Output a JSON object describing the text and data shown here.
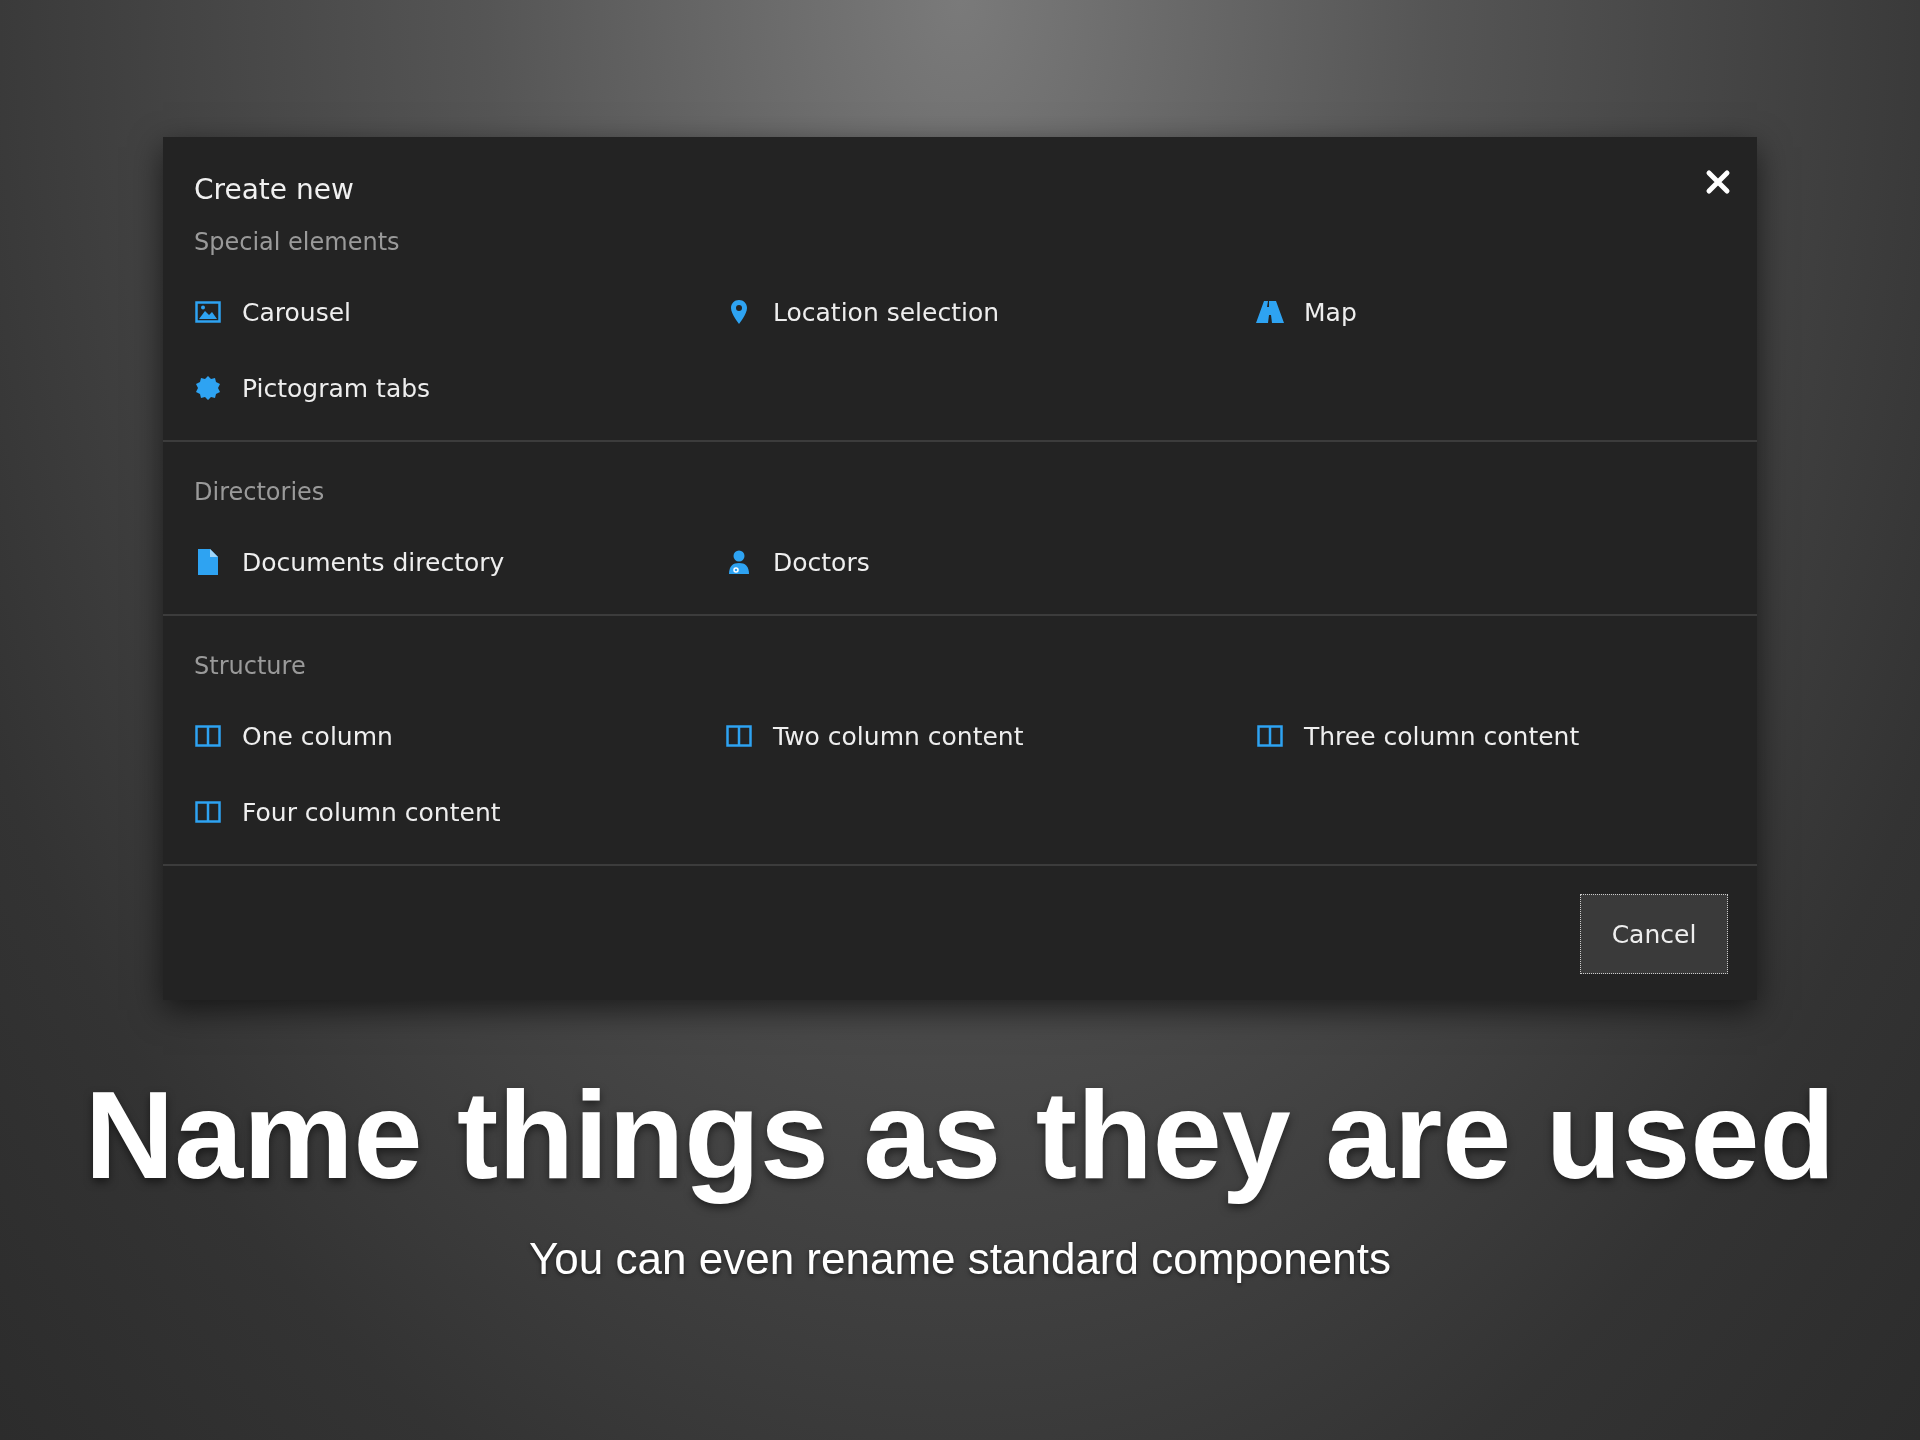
{
  "dialog": {
    "title": "Create new",
    "sections": [
      {
        "title": "Special elements",
        "items": [
          {
            "label": "Carousel",
            "kind": "image"
          },
          {
            "label": "Location selection",
            "kind": "pin"
          },
          {
            "label": "Map",
            "kind": "road"
          },
          {
            "label": "Pictogram tabs",
            "kind": "badge"
          }
        ]
      },
      {
        "title": "Directories",
        "items": [
          {
            "label": "Documents directory",
            "kind": "file"
          },
          {
            "label": "Doctors",
            "kind": "person"
          }
        ]
      },
      {
        "title": "Structure",
        "items": [
          {
            "label": "One column",
            "kind": "columns"
          },
          {
            "label": "Two column content",
            "kind": "columns"
          },
          {
            "label": "Three column content",
            "kind": "columns"
          },
          {
            "label": "Four column content",
            "kind": "columns"
          }
        ]
      }
    ],
    "cancel": "Cancel"
  },
  "headline": "Name things as they are used",
  "subtitle": "You can even rename standard components"
}
